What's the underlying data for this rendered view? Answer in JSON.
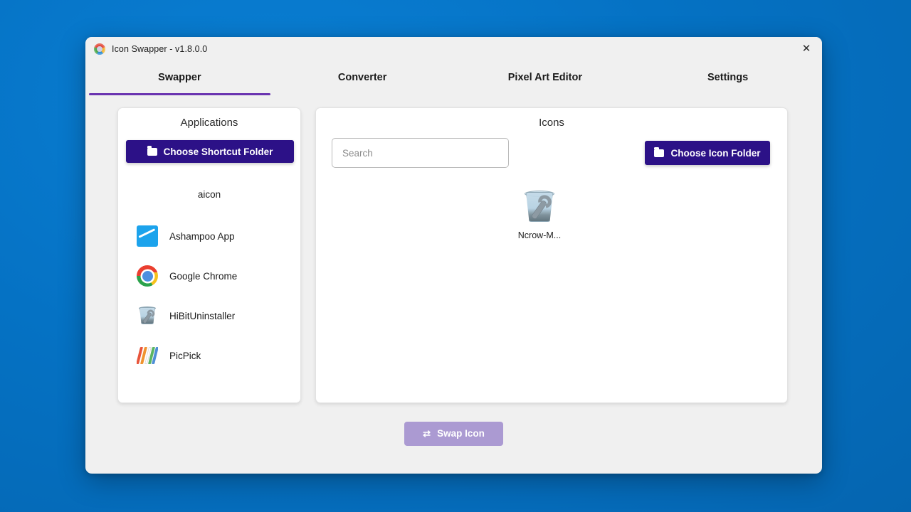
{
  "window": {
    "title": "Icon Swapper - v1.8.0.0",
    "app_icon": "icon-swapper-logo",
    "close_label": "✕"
  },
  "tabs": [
    {
      "label": "Swapper",
      "active": true
    },
    {
      "label": "Converter",
      "active": false
    },
    {
      "label": "Pixel Art Editor",
      "active": false
    },
    {
      "label": "Settings",
      "active": false
    }
  ],
  "applications_panel": {
    "title": "Applications",
    "choose_folder_label": "Choose Shortcut Folder",
    "folder_name": "aicon",
    "items": [
      {
        "name": "Ashampoo App",
        "icon": "ashampoo-icon"
      },
      {
        "name": "Google Chrome",
        "icon": "chrome-icon"
      },
      {
        "name": "HiBitUninstaller",
        "icon": "trash-wrench-icon"
      },
      {
        "name": "PicPick",
        "icon": "picpick-icon"
      }
    ]
  },
  "icons_panel": {
    "title": "Icons",
    "search_placeholder": "Search",
    "search_value": "",
    "choose_folder_label": "Choose Icon Folder",
    "items": [
      {
        "name": "Ncrow-M...",
        "icon": "trash-wrench-icon"
      }
    ]
  },
  "footer": {
    "swap_label": "Swap Icon",
    "swap_glyph": "⇄"
  },
  "colors": {
    "accent_purple": "#2c1187",
    "tab_underline": "#6a33b0",
    "swap_disabled": "#ab9ad2",
    "desktop_blue": "#0572c4",
    "window_bg": "#f0f0f0"
  }
}
